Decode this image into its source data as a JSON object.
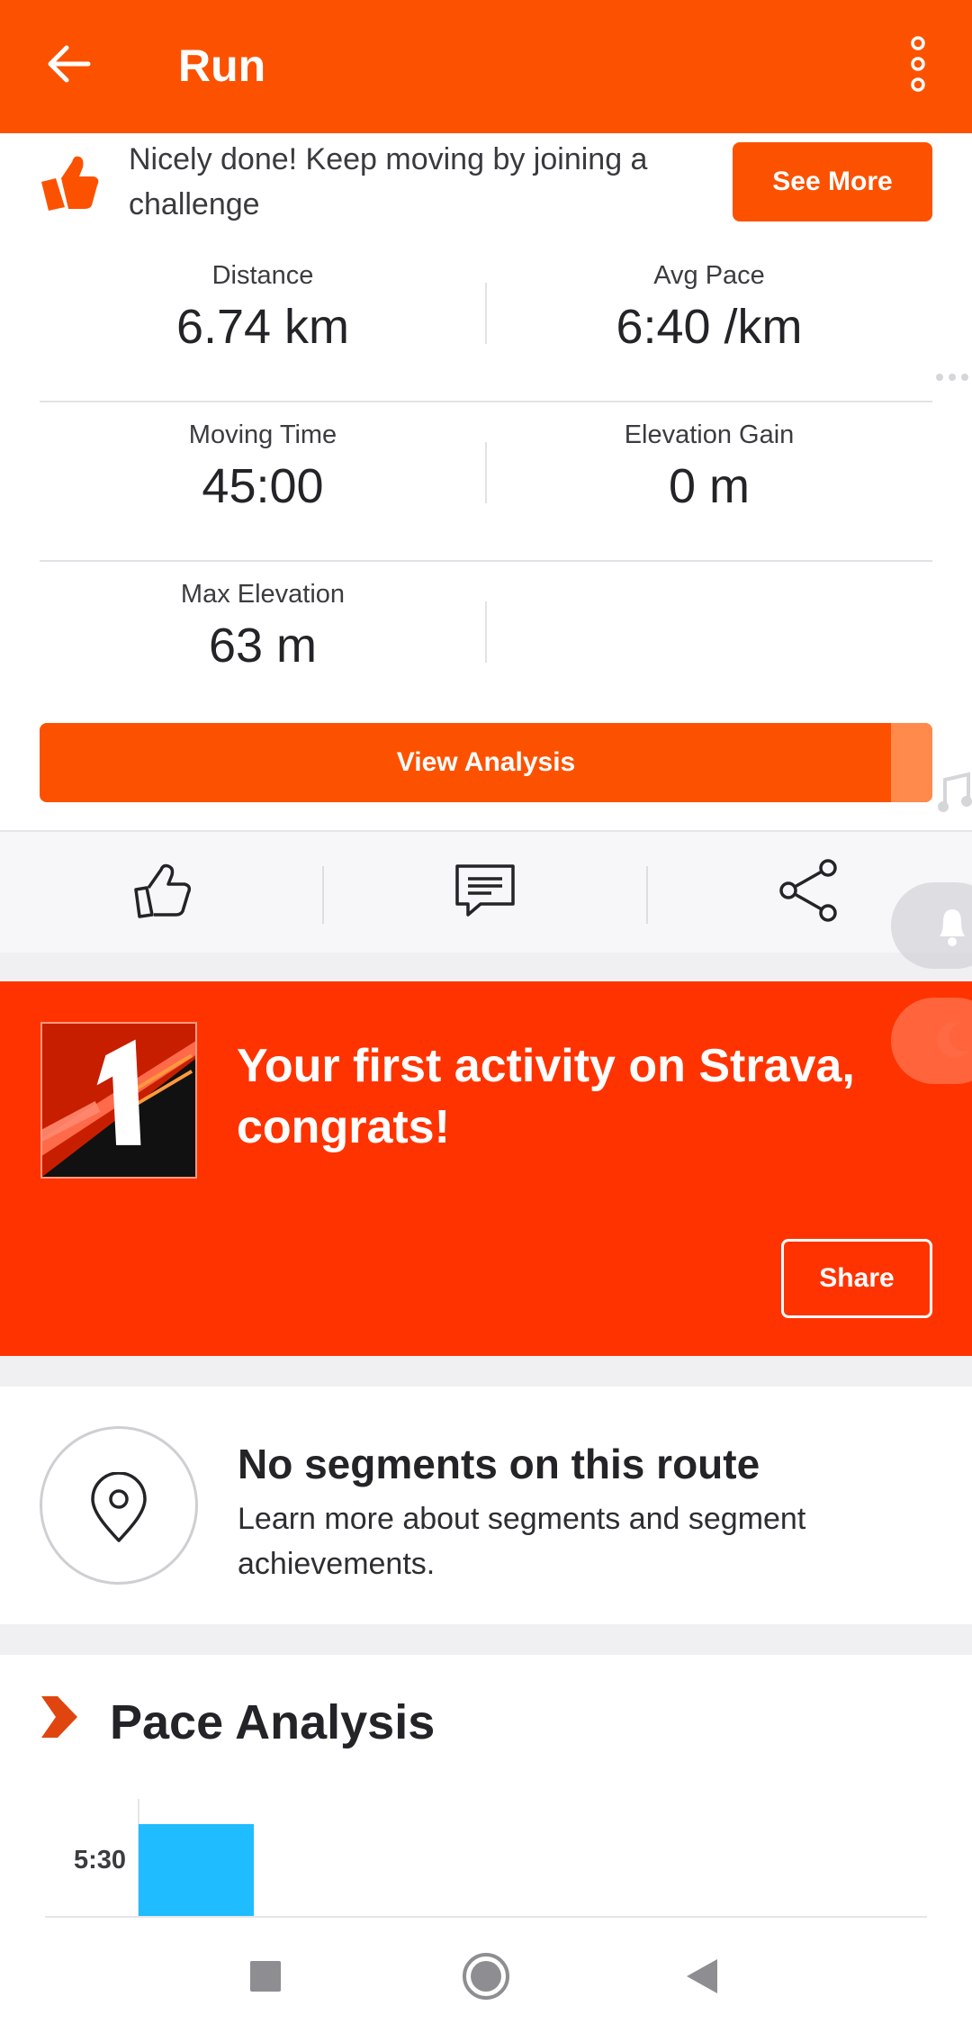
{
  "app_bar": {
    "title": "Run",
    "background": "#fc5200",
    "back_icon": "arrow-left-icon",
    "menu_icon": "more-vertical-icon"
  },
  "challenge_prompt": {
    "message": "Nicely done! Keep moving by joining a challenge",
    "icon": "thumbs-up-icon",
    "button_label": "See More"
  },
  "stats": [
    {
      "label": "Distance",
      "value": "6.74 km"
    },
    {
      "label": "Avg Pace",
      "value": "6:40 /km"
    },
    {
      "label": "Moving Time",
      "value": "45:00"
    },
    {
      "label": "Elevation Gain",
      "value": "0 m"
    },
    {
      "label": "Max Elevation",
      "value": "63 m"
    }
  ],
  "analysis_button": "View Analysis",
  "actions": {
    "kudos_icon": "thumbs-up-outline-icon",
    "comment_icon": "comment-icon",
    "share_icon": "share-icon"
  },
  "first_activity": {
    "headline": "Your first activity on Strava, congrats!",
    "share_label": "Share",
    "badge_icon": "first-activity-badge-icon",
    "background": "#ff3300"
  },
  "segments": {
    "title": "No segments on this route",
    "description": "Learn more about segments and segment achievements.",
    "icon": "location-pin-icon"
  },
  "pace_analysis": {
    "title": "Pace Analysis",
    "icon": "chevron-right-icon"
  },
  "chart_data": {
    "type": "bar",
    "ytick_labels": [
      "5:30"
    ],
    "series": [
      {
        "values": [
          5.5
        ]
      }
    ],
    "bar_color": "#1fbcff"
  },
  "system_nav": {
    "recents_icon": "square-icon",
    "home_icon": "circle-icon",
    "back_icon": "triangle-back-icon"
  }
}
